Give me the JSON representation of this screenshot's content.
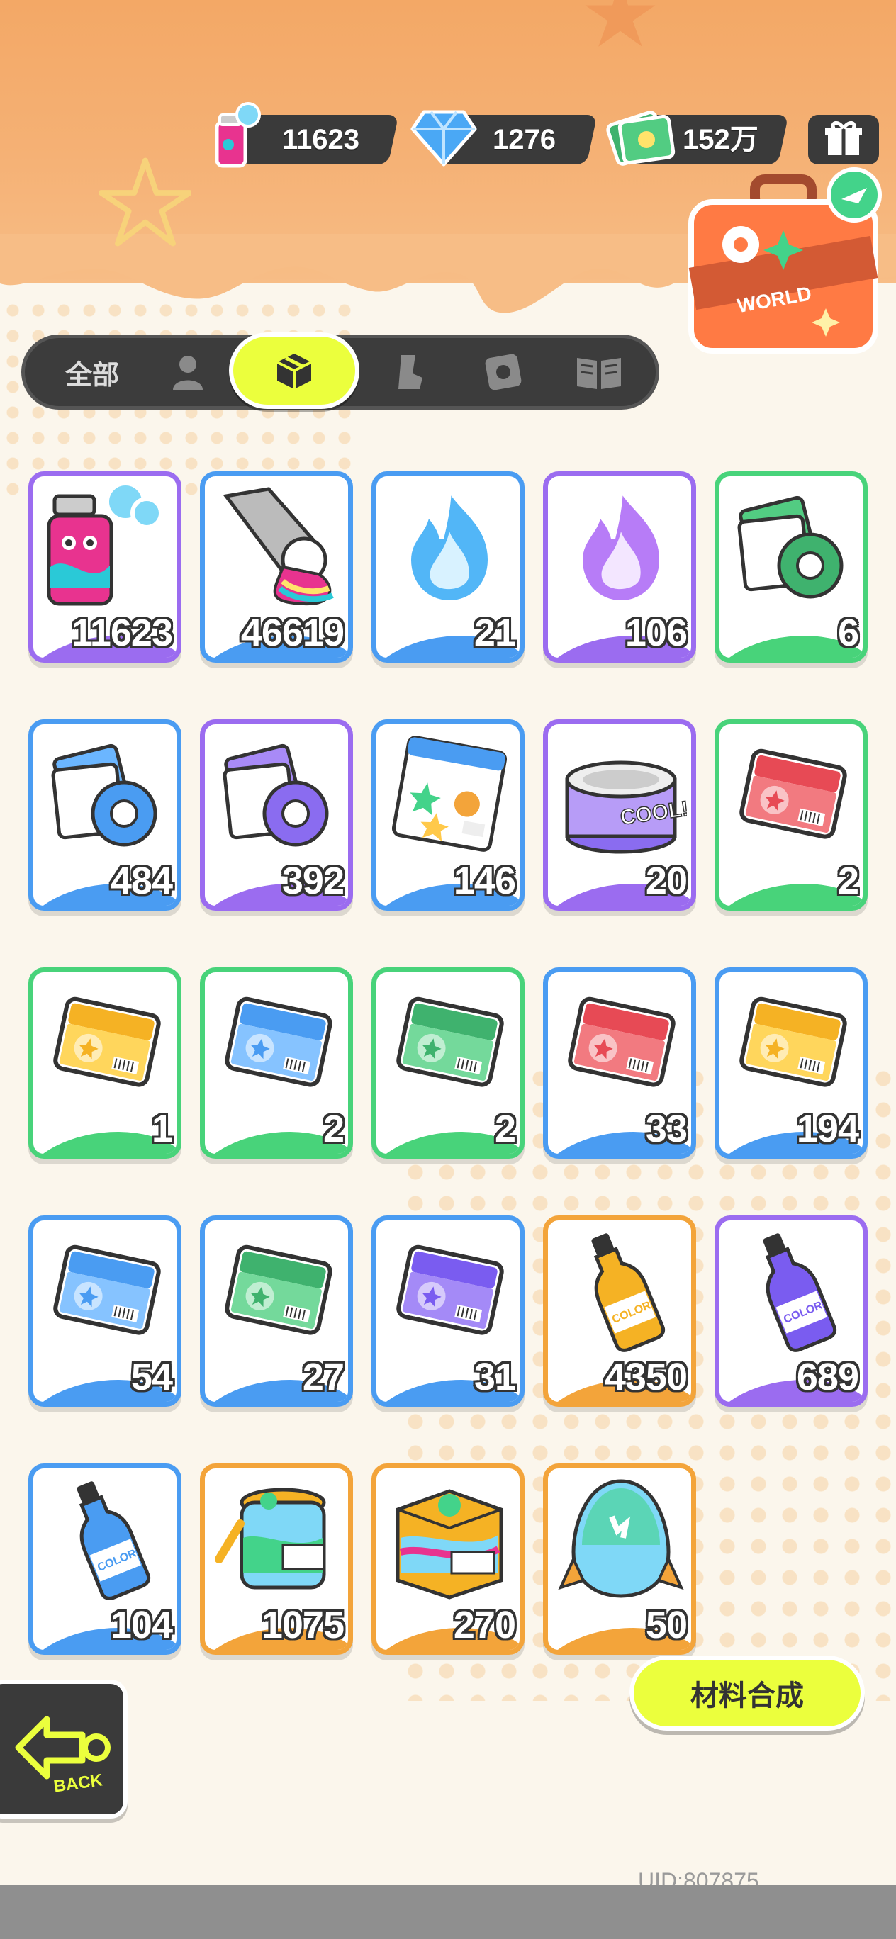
{
  "currencies": [
    {
      "name": "spray-paint",
      "value": "11623",
      "icon": "spray-can-icon"
    },
    {
      "name": "diamond",
      "value": "1276",
      "icon": "diamond-icon"
    },
    {
      "name": "cash",
      "value": "152万",
      "icon": "cash-icon"
    }
  ],
  "suitcase": {
    "label": "WORLD"
  },
  "tabs": [
    {
      "label": "全部",
      "icon": null
    },
    {
      "label": "",
      "icon": "person-icon"
    },
    {
      "label": "",
      "icon": "box-icon",
      "active": true
    },
    {
      "label": "",
      "icon": "shoe-icon"
    },
    {
      "label": "",
      "icon": "sticker-icon"
    },
    {
      "label": "",
      "icon": "book-icon"
    }
  ],
  "items": [
    {
      "icon": "spray-can-icon",
      "count": "11623",
      "rarity": "purple"
    },
    {
      "icon": "paint-tube-icon",
      "count": "46619",
      "rarity": "blue"
    },
    {
      "icon": "blue-flame-icon",
      "count": "21",
      "rarity": "blue"
    },
    {
      "icon": "purple-flame-icon",
      "count": "106",
      "rarity": "purple"
    },
    {
      "icon": "green-tape-icon",
      "count": "6",
      "rarity": "green"
    },
    {
      "icon": "blue-tape-icon",
      "count": "484",
      "rarity": "blue"
    },
    {
      "icon": "purple-tape-icon",
      "count": "392",
      "rarity": "purple"
    },
    {
      "icon": "sticker-pack-icon",
      "count": "146",
      "rarity": "blue"
    },
    {
      "icon": "cool-can-icon",
      "count": "20",
      "rarity": "purple"
    },
    {
      "icon": "red-ticket-icon",
      "count": "2",
      "rarity": "green"
    },
    {
      "icon": "yellow-ticket-icon",
      "count": "1",
      "rarity": "green"
    },
    {
      "icon": "blue-ticket-icon",
      "count": "2",
      "rarity": "green"
    },
    {
      "icon": "green-ticket-icon",
      "count": "2",
      "rarity": "green"
    },
    {
      "icon": "red-ticket-icon",
      "count": "33",
      "rarity": "blue"
    },
    {
      "icon": "yellow-ticket-icon",
      "count": "194",
      "rarity": "blue"
    },
    {
      "icon": "blue-ticket-icon",
      "count": "54",
      "rarity": "blue"
    },
    {
      "icon": "green-ticket-icon",
      "count": "27",
      "rarity": "blue"
    },
    {
      "icon": "purple-ticket-icon",
      "count": "31",
      "rarity": "blue"
    },
    {
      "icon": "orange-bottle-icon",
      "count": "4350",
      "rarity": "orange"
    },
    {
      "icon": "purple-bottle-icon",
      "count": "689",
      "rarity": "purple"
    },
    {
      "icon": "blue-bottle-icon",
      "count": "104",
      "rarity": "blue"
    },
    {
      "icon": "paint-jar-icon",
      "count": "1075",
      "rarity": "orange"
    },
    {
      "icon": "paint-box-icon",
      "count": "270",
      "rarity": "orange"
    },
    {
      "icon": "egg-capsule-icon",
      "count": "50",
      "rarity": "orange"
    }
  ],
  "synthesize_label": "材料合成",
  "back_label": "BACK",
  "uid": "UID:807875",
  "colors": {
    "accent": "#ebff3d",
    "purple": "#9b6cf0",
    "blue": "#4a9cf2",
    "green": "#48d37a",
    "orange": "#f3a43a"
  }
}
